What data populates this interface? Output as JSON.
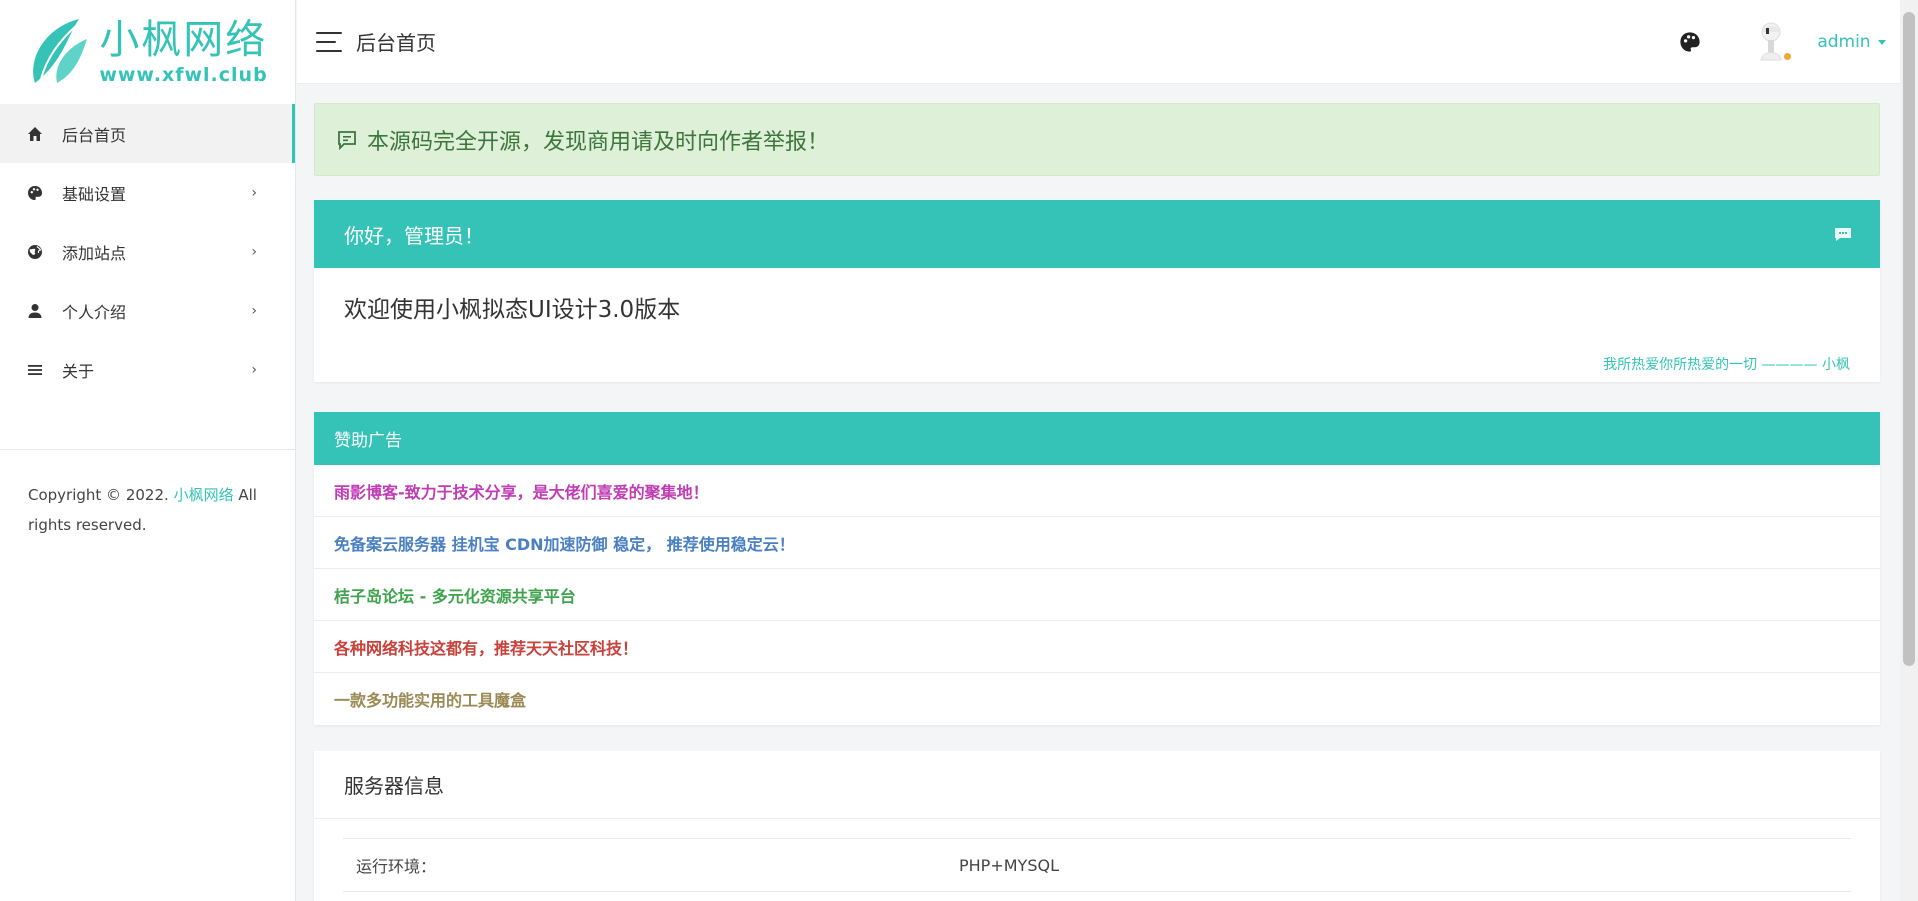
{
  "brand": {
    "logo_title": "小枫网络",
    "logo_url": "www.xfwl.club",
    "accent_color": "#35c3b7"
  },
  "sidebar": {
    "items": [
      {
        "label": "后台首页",
        "icon": "home-icon",
        "active": true,
        "has_arrow": false
      },
      {
        "label": "基础设置",
        "icon": "palette-icon",
        "active": false,
        "has_arrow": true
      },
      {
        "label": "添加站点",
        "icon": "globe-icon",
        "active": false,
        "has_arrow": true
      },
      {
        "label": "个人介绍",
        "icon": "person-icon",
        "active": false,
        "has_arrow": true
      },
      {
        "label": "关于",
        "icon": "menu-lines-icon",
        "active": false,
        "has_arrow": true
      }
    ],
    "arrow": "›",
    "copyright_prefix": "Copyright © 2022.",
    "copyright_brand": "小枫网络",
    "copyright_suffix": "All rights reserved."
  },
  "header": {
    "title": "后台首页",
    "username": "admin"
  },
  "notice": {
    "text": "本源码完全开源，发现商用请及时向作者举报！",
    "bg_color": "#dff0d8"
  },
  "welcome": {
    "heading": "你好，管理员！",
    "body": "欢迎使用小枫拟态UI设计3.0版本",
    "sign": "我所热爱你所热爱的一切 ———— 小枫"
  },
  "ads": {
    "heading": "赞助广告",
    "items": [
      {
        "text": "雨影博客-致力于技术分享，是大佬们喜爱的聚集地！",
        "color": "#c03cb4"
      },
      {
        "text": "免备案云服务器 挂机宝 CDN加速防御 稳定， 推荐使用稳定云！",
        "color": "#4a7fc1"
      },
      {
        "text": "桔子岛论坛 - 多元化资源共享平台",
        "color": "#3fa34d"
      },
      {
        "text": "各种网络科技这都有，推荐天天社区科技！",
        "color": "#c8413a"
      },
      {
        "text": "一款多功能实用的工具魔盒",
        "color": "#9a8a55"
      }
    ]
  },
  "server": {
    "title": "服务器信息",
    "rows": [
      {
        "key": "运行环境：",
        "value": "PHP+MYSQL"
      }
    ]
  }
}
